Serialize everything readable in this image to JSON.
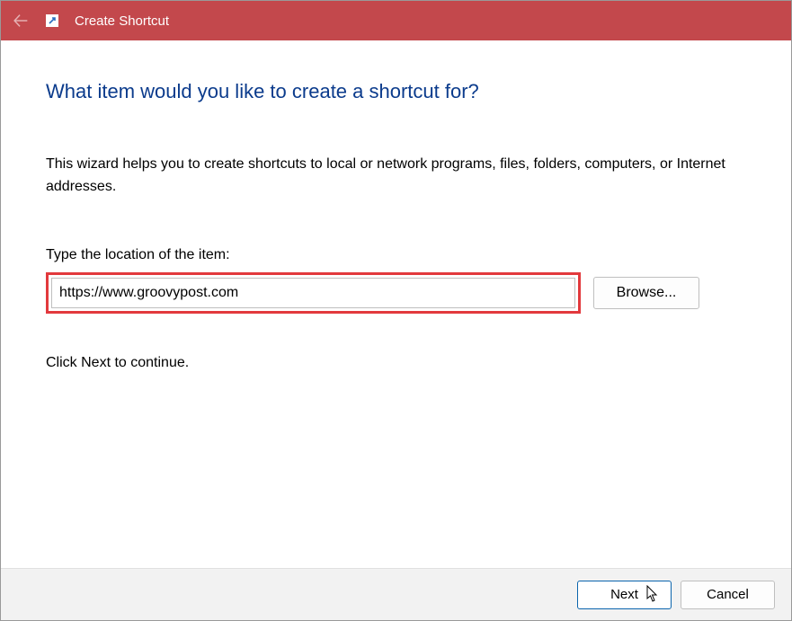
{
  "titlebar": {
    "title": "Create Shortcut"
  },
  "main": {
    "heading": "What item would you like to create a shortcut for?",
    "description": "This wizard helps you to create shortcuts to local or network programs, files, folders, computers, or Internet addresses.",
    "location_label": "Type the location of the item:",
    "location_value": "https://www.groovypost.com",
    "browse_label": "Browse...",
    "continue_text": "Click Next to continue."
  },
  "footer": {
    "next_label": "Next",
    "cancel_label": "Cancel"
  }
}
